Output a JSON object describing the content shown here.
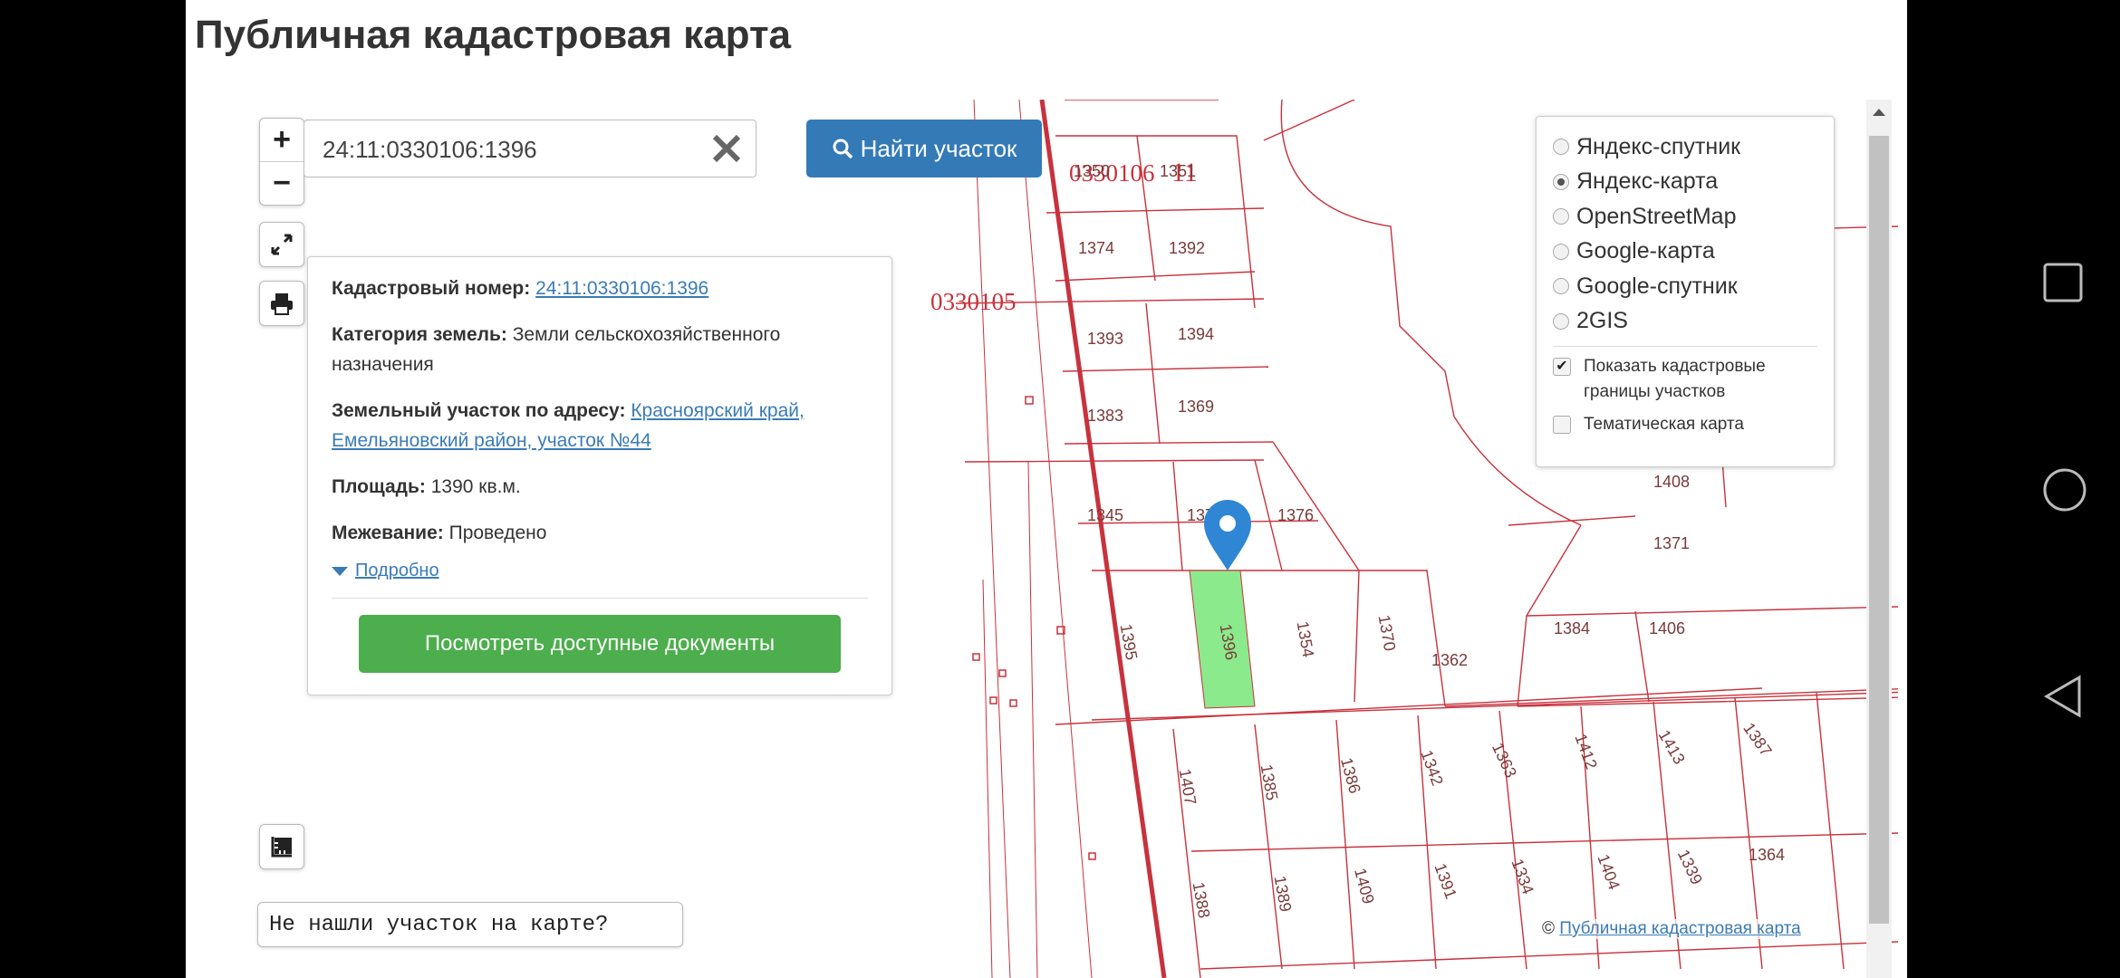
{
  "page": {
    "title": "Публичная кадастровая карта"
  },
  "search": {
    "value": "24:11:0330106:1396",
    "button": "Найти участок"
  },
  "info": {
    "cad_label": "Кадастровый номер:",
    "cad_value": "24:11:0330106:1396",
    "cat_label": "Категория земель:",
    "cat_value": "Земли сельскохозяйственного назначения",
    "addr_label": "Земельный участок по адресу:",
    "addr_value": "Красноярский край, Емельяновский район, участок №44",
    "area_label": "Площадь:",
    "area_value": "1390 кв.м.",
    "survey_label": "Межевание:",
    "survey_value": "Проведено",
    "more": "Подробно",
    "docs_button": "Посмотреть доступные документы"
  },
  "layers": {
    "items": [
      {
        "label": "Яндекс-спутник",
        "selected": false
      },
      {
        "label": "Яндекс-карта",
        "selected": true
      },
      {
        "label": "OpenStreetMap",
        "selected": false
      },
      {
        "label": "Google-карта",
        "selected": false
      },
      {
        "label": "Google-спутник",
        "selected": false
      },
      {
        "label": "2GIS",
        "selected": false
      }
    ],
    "show_borders": "Показать кадастровые границы участков",
    "show_borders_checked": true,
    "thematic": "Тематическая карта",
    "thematic_checked": false
  },
  "map": {
    "quarter_main": "0330106",
    "quarter_suffix": "11",
    "quarter_other": "0330105",
    "parcels": [
      "1350",
      "1351",
      "1374",
      "1392",
      "1393",
      "1394",
      "1383",
      "1369",
      "1345",
      "1375",
      "1376",
      "1408",
      "1371",
      "1395",
      "1396",
      "1354",
      "1370",
      "1362",
      "1384",
      "1406",
      "1407",
      "1385",
      "1386",
      "1342",
      "1363",
      "1412",
      "1413",
      "1387",
      "1388",
      "1389",
      "1409",
      "1391",
      "1334",
      "1404",
      "1339",
      "1364"
    ]
  },
  "not_found": "Не нашли участок на карте?",
  "attribution": {
    "symbol": "©",
    "link": "Публичная кадастровая карта"
  },
  "colors": {
    "parcel_line": "#c8323c",
    "selected_parcel": "#7ee87e",
    "primary": "#337ab7",
    "success": "#4cae4c",
    "marker": "#2f86d4"
  }
}
